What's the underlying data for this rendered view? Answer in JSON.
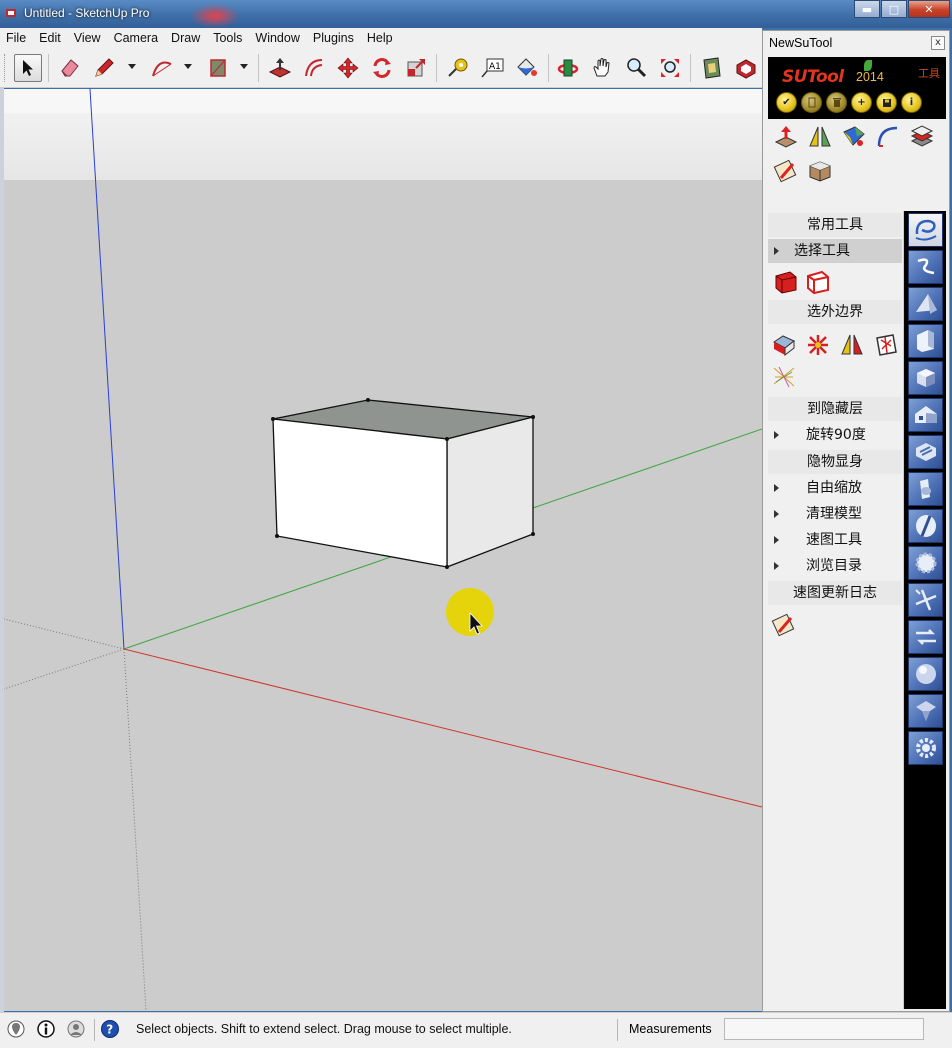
{
  "window": {
    "title": "Untitled - SketchUp Pro",
    "buttons": {
      "minimize": "▬",
      "maximize": "□",
      "close": "✕"
    }
  },
  "menu": [
    "File",
    "Edit",
    "View",
    "Camera",
    "Draw",
    "Tools",
    "Window",
    "Plugins",
    "Help"
  ],
  "toolbar": {
    "tools": [
      {
        "name": "select-tool-icon"
      },
      {
        "name": "eraser-tool-icon"
      },
      {
        "name": "pencil-line-tool-icon"
      },
      {
        "name": "arc-tool-icon"
      },
      {
        "name": "rectangle-tool-icon"
      },
      {
        "name": "push-pull-tool-icon"
      },
      {
        "name": "offset-tool-icon"
      },
      {
        "name": "move-tool-icon"
      },
      {
        "name": "rotate-tool-icon"
      },
      {
        "name": "scale-tool-icon"
      },
      {
        "name": "tape-measure-tool-icon"
      },
      {
        "name": "text-tool-icon"
      },
      {
        "name": "paint-bucket-tool-icon"
      },
      {
        "name": "orbit-tool-icon"
      },
      {
        "name": "pan-tool-icon"
      },
      {
        "name": "zoom-tool-icon"
      },
      {
        "name": "zoom-extents-tool-icon"
      },
      {
        "name": "warehouse-icon"
      },
      {
        "name": "extension-warehouse-icon"
      }
    ],
    "text_tool_label": "A1"
  },
  "status": {
    "message": "Select objects. Shift to extend select. Drag mouse to select multiple.",
    "measurements_label": "Measurements",
    "measurements_value": ""
  },
  "panel": {
    "title": "NewSuTool",
    "close_label": "x",
    "brand": {
      "logo": "SUTool",
      "year": "2014",
      "tag": "工具"
    },
    "yellow_buttons": [
      "✔",
      "",
      "",
      "+",
      "",
      "i"
    ],
    "list": [
      {
        "label": "常用工具",
        "type": "header-center"
      },
      {
        "label": "选择工具",
        "type": "header-arrow",
        "selected": true
      },
      {
        "label": "选外边界",
        "type": "header-center"
      },
      {
        "label": "到隐藏层",
        "type": "header-center"
      },
      {
        "label": "旋转90度",
        "type": "arrow"
      },
      {
        "label": "隐物显身",
        "type": "header-center"
      },
      {
        "label": "自由缩放",
        "type": "arrow"
      },
      {
        "label": "清理模型",
        "type": "arrow"
      },
      {
        "label": "速图工具",
        "type": "arrow"
      },
      {
        "label": "浏览目录",
        "type": "arrow"
      },
      {
        "label": "速图更新日志",
        "type": "header-center"
      }
    ]
  },
  "colors": {
    "viewport_bg": "#cccccc",
    "axis_red": "#d0342c",
    "axis_green": "#3fa63f",
    "axis_blue": "#2b3fd0",
    "cursor_highlight": "#e6d400",
    "panel_tab_blue": "#4a6db3"
  }
}
